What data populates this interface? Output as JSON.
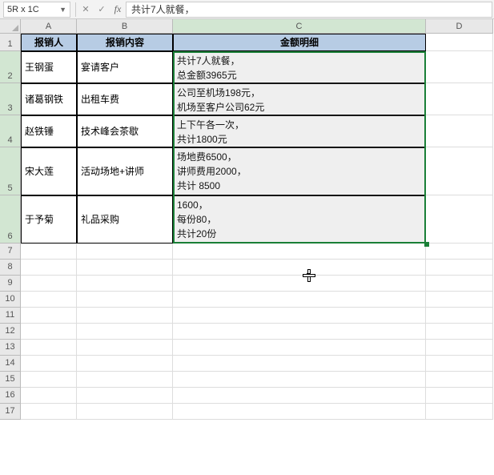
{
  "namebox": "5R x 1C",
  "formula_value": "共计7人就餐，",
  "columns": [
    "A",
    "B",
    "C",
    "D"
  ],
  "selected_col": "C",
  "row_numbers": [
    1,
    2,
    3,
    4,
    5,
    6,
    7,
    8,
    9,
    10,
    11,
    12,
    13,
    14,
    15,
    16,
    17
  ],
  "selected_rows": [
    2,
    3,
    4,
    5,
    6
  ],
  "headers": {
    "a": "报销人",
    "b": "报销内容",
    "c": "金额明细"
  },
  "rows_data": [
    {
      "a": "王钢蛋",
      "b": "宴请客户",
      "c": "共计7人就餐，\n总金额3965元"
    },
    {
      "a": "诸葛钢铁",
      "b": "出租车费",
      "c": "公司至机场198元，\n机场至客户公司62元"
    },
    {
      "a": "赵铁锤",
      "b": "技术峰会茶歇",
      "c": "上下午各一次，\n共计1800元"
    },
    {
      "a": "宋大莲",
      "b": "活动场地+讲师",
      "c": "场地费6500，\n讲师费用2000，\n共计 8500"
    },
    {
      "a": "于予菊",
      "b": "礼品采购",
      "c": "1600，\n每份80，\n共计20份"
    }
  ]
}
